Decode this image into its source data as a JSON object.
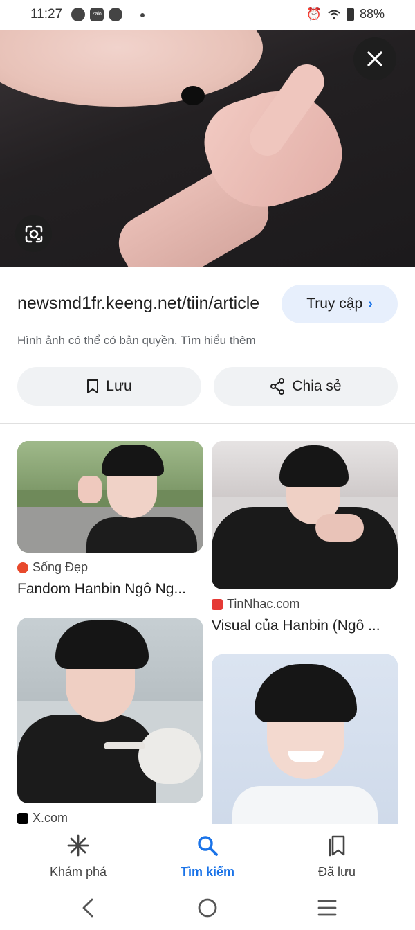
{
  "status_bar": {
    "time": "11:27",
    "battery": "88%"
  },
  "hero": {
    "close_icon": "close-icon",
    "lens_icon": "google-lens-icon"
  },
  "source": {
    "url": "newsmd1fr.keeng.net/tiin/article",
    "visit_label": "Truy cập",
    "copyright": "Hình ảnh có thể có bản quyền. Tìm hiểu thêm"
  },
  "actions": {
    "save_label": "Lưu",
    "share_label": "Chia sẻ"
  },
  "results": [
    {
      "source": "Sống Đẹp",
      "title": "Fandom Hanbin Ngô Ng...",
      "source_color": "#e8492c"
    },
    {
      "source": "TinNhac.com",
      "title": "Visual của Hanbin (Ngô ...",
      "source_color": "#e53935"
    },
    {
      "source": "X.com",
      "title": "",
      "source_color": "#000000"
    },
    {
      "source": "",
      "title": ""
    }
  ],
  "bottom_nav": [
    {
      "label": "Khám phá",
      "icon": "discover-icon"
    },
    {
      "label": "Tìm kiếm",
      "icon": "search-icon"
    },
    {
      "label": "Đã lưu",
      "icon": "saved-icon"
    }
  ],
  "colors": {
    "accent": "#1a73e8",
    "pill_bg": "#f0f2f4",
    "visit_bg": "#e7effc"
  }
}
